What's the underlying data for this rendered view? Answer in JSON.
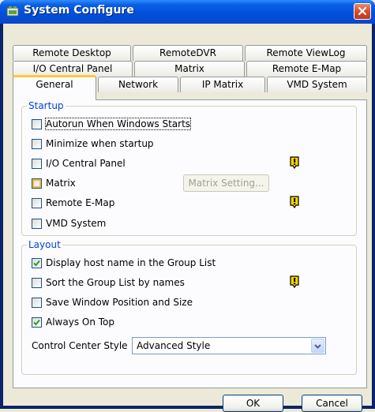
{
  "window": {
    "title": "System Configure"
  },
  "tabs": {
    "row1": [
      "Remote Desktop",
      "RemoteDVR",
      "Remote ViewLog"
    ],
    "row2": [
      "I/O Central Panel",
      "Matrix",
      "Remote E-Map"
    ],
    "row3": [
      "General",
      "Network",
      "IP Matrix",
      "VMD System"
    ],
    "active": "General"
  },
  "startup": {
    "label": "Startup",
    "items": [
      {
        "label": "Autorun When Windows Starts",
        "checked": false
      },
      {
        "label": "Minimize when startup",
        "checked": false
      },
      {
        "label": "I/O Central Panel",
        "checked": false,
        "warning": true
      },
      {
        "label": "Matrix",
        "checked": false,
        "highlighted": true
      },
      {
        "label": "Remote E-Map",
        "checked": false,
        "warning": true
      },
      {
        "label": "VMD System",
        "checked": false
      }
    ],
    "matrix_setting_button": "Matrix Setting..."
  },
  "layout": {
    "label": "Layout",
    "items": [
      {
        "label": "Display host name in the Group List",
        "checked": true
      },
      {
        "label": "Sort the Group List by names",
        "checked": false,
        "warning": true
      },
      {
        "label": "Save Window Position and Size",
        "checked": false
      },
      {
        "label": "Always On Top",
        "checked": true
      }
    ],
    "control_center_style_label": "Control Center Style",
    "control_center_style_value": "Advanced Style"
  },
  "buttons": {
    "ok": "OK",
    "cancel": "Cancel"
  },
  "icons": [
    "app-icon",
    "close-icon",
    "warning-icon",
    "checkmark-icon",
    "chevron-down-icon"
  ],
  "colors": {
    "titlebar": "#0050dc",
    "group_label": "#0046d5",
    "active_tab_accent": "#ffc73c",
    "warning": "#f5d700"
  }
}
